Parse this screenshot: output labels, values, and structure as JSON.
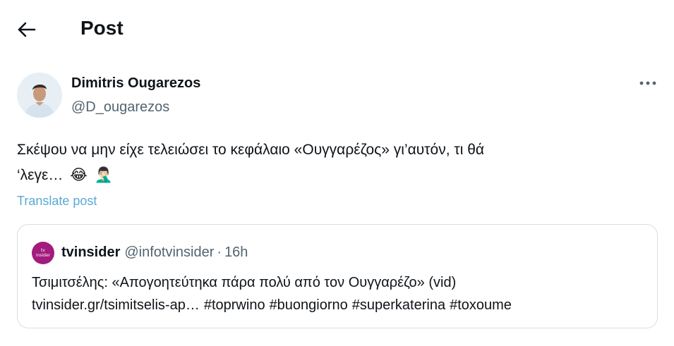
{
  "header": {
    "title": "Post"
  },
  "tweet": {
    "author_name": "Dimitris Ougarezos",
    "author_handle": "@D_ougarezos",
    "text_line1": "Σκέψου να μην είχε τελειώσει το κεφάλαιο «Ουγγαρέζος» γι’αυτόν, τι θά",
    "text_line2": "‘λεγε…",
    "emoji_1": "😂",
    "emoji_2": "🤦🏻‍♂️",
    "translate_label": "Translate post"
  },
  "quote": {
    "name": "tvinsider",
    "handle": "@infotvinsider",
    "separator": "·",
    "time": "16h",
    "avatar_text_top": "tv",
    "avatar_text_bottom": "insider",
    "line1": "Τσιμιτσέλης: «Απογοητεύτηκα πάρα πολύ από τον Ουγγαρέζο» (vid)",
    "link": "tvinsider.gr/tsimitselis-ap…",
    "hashtags": [
      "#toprwino",
      "#buongiorno",
      "#superkaterina",
      "#toxoume"
    ]
  },
  "colors": {
    "text_primary": "#0f1419",
    "text_secondary": "#536471",
    "translate_link": "#5aa9d6",
    "quote_border": "#d9dee2",
    "quote_avatar_bg": "#a21b7d"
  },
  "icons": {
    "back": "arrow-left-icon",
    "more": "more-horizontal-icon"
  }
}
